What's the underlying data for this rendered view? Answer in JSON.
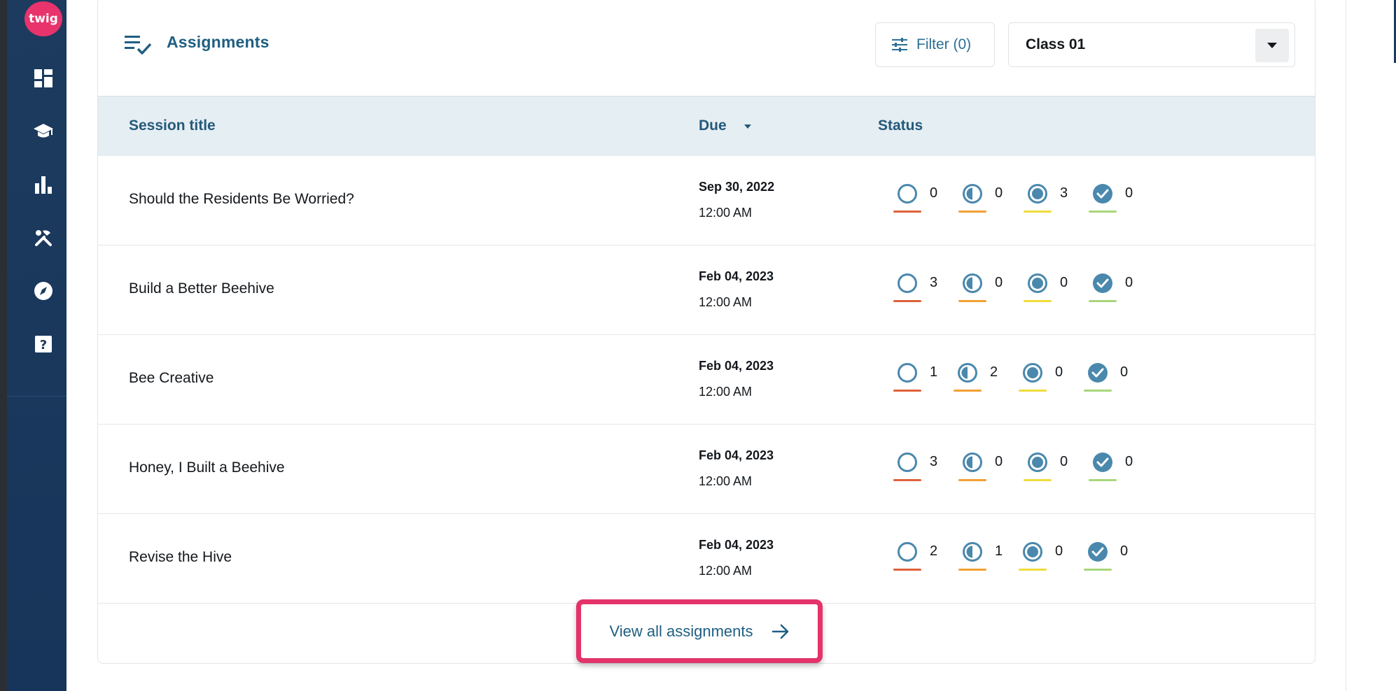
{
  "brand": {
    "logo_text": "twig",
    "accent": "#e8336c",
    "sidebar_bg": "#1c3b5e"
  },
  "sidebar": {
    "items": [
      {
        "name": "dashboard",
        "icon": "dashboard-icon"
      },
      {
        "name": "learn",
        "icon": "graduation-cap-icon"
      },
      {
        "name": "reports",
        "icon": "bar-chart-icon"
      },
      {
        "name": "tools",
        "icon": "tools-icon"
      },
      {
        "name": "explore",
        "icon": "compass-icon"
      },
      {
        "name": "help",
        "icon": "help-icon"
      }
    ]
  },
  "assignments": {
    "title": "Assignments",
    "filter_label": "Filter (0)",
    "class_selected": "Class 01",
    "columns": {
      "session": "Session title",
      "due": "Due",
      "status": "Status"
    },
    "status_colors": {
      "not_started": "#e0603a",
      "in_progress": "#f2a033",
      "submitted": "#f0dc3a",
      "completed": "#a8d67a"
    },
    "rows": [
      {
        "title": "Should the Residents Be Worried?",
        "date": "Sep 30, 2022",
        "time": "12:00 AM",
        "counts": [
          "0",
          "0",
          "3",
          "0"
        ]
      },
      {
        "title": "Build a Better Beehive",
        "date": "Feb 04, 2023",
        "time": "12:00 AM",
        "counts": [
          "3",
          "0",
          "0",
          "0"
        ]
      },
      {
        "title": "Bee Creative",
        "date": "Feb 04, 2023",
        "time": "12:00 AM",
        "counts": [
          "1",
          "2",
          "0",
          "0"
        ]
      },
      {
        "title": "Honey, I Built a Beehive",
        "date": "Feb 04, 2023",
        "time": "12:00 AM",
        "counts": [
          "3",
          "0",
          "0",
          "0"
        ]
      },
      {
        "title": "Revise the Hive",
        "date": "Feb 04, 2023",
        "time": "12:00 AM",
        "counts": [
          "2",
          "1",
          "0",
          "0"
        ]
      }
    ],
    "view_all_label": "View all assignments"
  }
}
